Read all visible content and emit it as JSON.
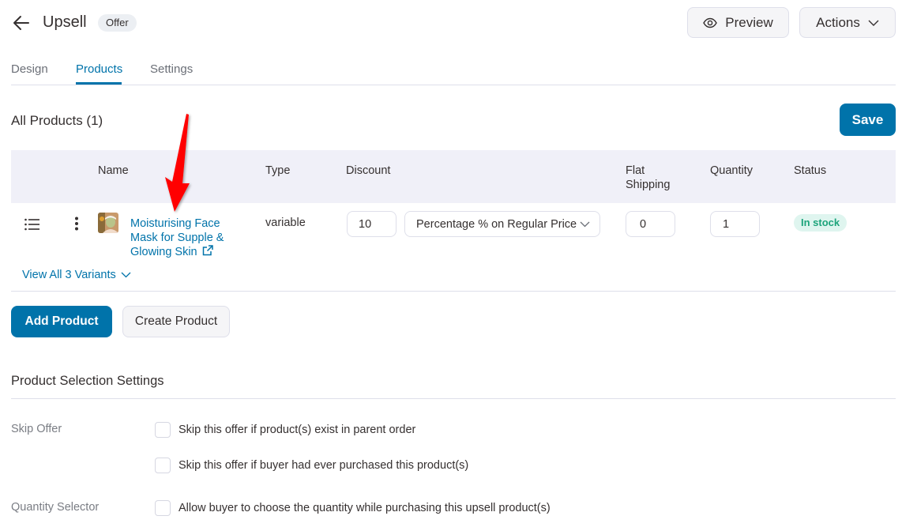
{
  "header": {
    "back_icon": "arrow-left-icon",
    "title": "Upsell",
    "badge": "Offer",
    "preview_label": "Preview",
    "preview_icon": "eye-icon",
    "actions_label": "Actions",
    "actions_icon": "chevron-down-icon"
  },
  "tabs": [
    {
      "label": "Design",
      "active": false
    },
    {
      "label": "Products",
      "active": true
    },
    {
      "label": "Settings",
      "active": false
    }
  ],
  "products": {
    "title": "All Products (1)",
    "save_label": "Save",
    "columns": [
      "Name",
      "Type",
      "Discount",
      "Flat Shipping",
      "Quantity",
      "Status"
    ],
    "rows": [
      {
        "name": "Moisturising Face Mask for Supple & Glowing Skin",
        "type": "variable",
        "discount_value": "10",
        "discount_type": "Percentage % on Regular Price",
        "flat_shipping": "0",
        "quantity": "1",
        "status": "In stock",
        "variants_link": "View All 3 Variants"
      }
    ],
    "add_product_label": "Add Product",
    "create_product_label": "Create Product"
  },
  "selection_settings": {
    "title": "Product Selection Settings",
    "skip_offer_label": "Skip Offer",
    "skip_options": [
      {
        "label": "Skip this offer if product(s) exist in parent order",
        "checked": false
      },
      {
        "label": "Skip this offer if buyer had ever purchased this product(s)",
        "checked": false
      }
    ],
    "quantity_selector_label": "Quantity Selector",
    "quantity_option": {
      "label": "Allow buyer to choose the quantity while purchasing this upsell product(s)",
      "checked": false
    }
  },
  "colors": {
    "primary": "#0073aa",
    "table_header_bg": "#f0f0f8",
    "in_stock_bg": "#dff5ef",
    "in_stock_text": "#1da47b",
    "annotation_arrow": "#ff0000"
  }
}
